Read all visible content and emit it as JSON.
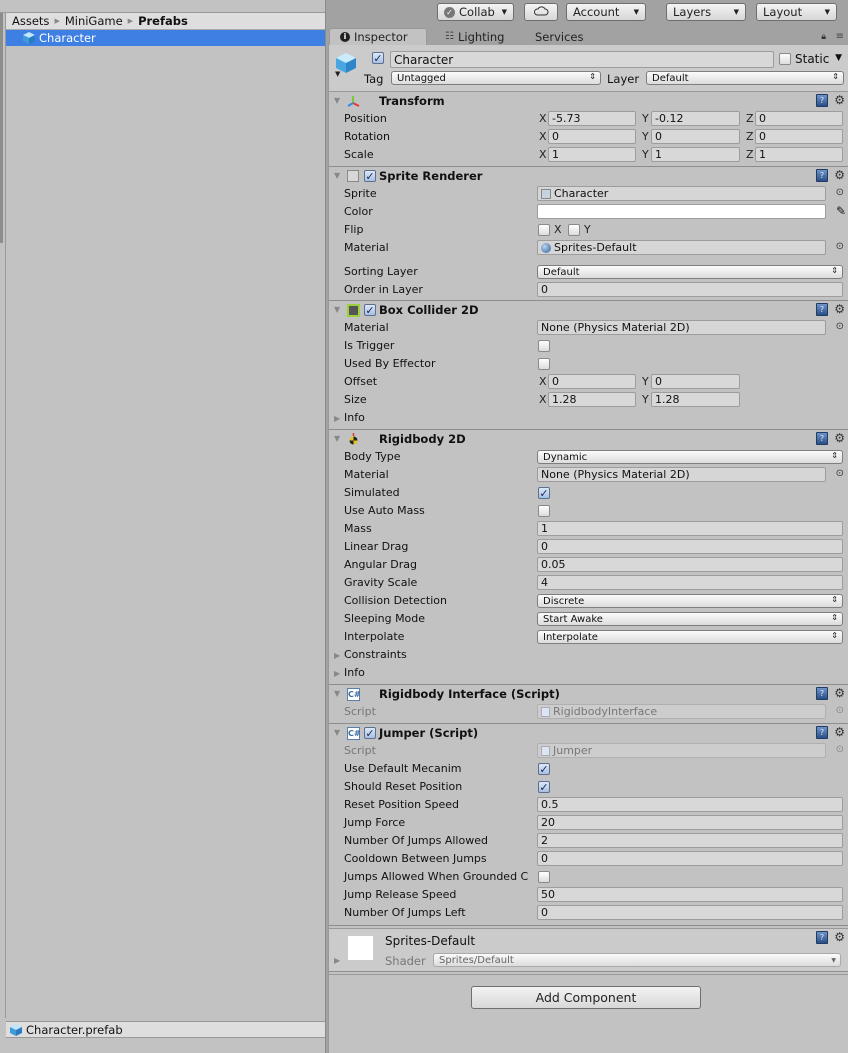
{
  "project": {
    "breadcrumb": [
      "Assets",
      "MiniGame",
      "Prefabs"
    ],
    "selected_item": "Character",
    "footer_file": "Character.prefab"
  },
  "toolbar": {
    "collab": "Collab",
    "account": "Account",
    "layers": "Layers",
    "layout": "Layout"
  },
  "tabs": [
    {
      "label": "Inspector",
      "icon": "info-icon",
      "active": true
    },
    {
      "label": "Lighting",
      "icon": "lighting-icon",
      "active": false
    },
    {
      "label": "Services",
      "icon": "",
      "active": false
    }
  ],
  "header": {
    "object_name": "Character",
    "active": true,
    "static_label": "Static",
    "static": false,
    "tag_label": "Tag",
    "tag_value": "Untagged",
    "layer_label": "Layer",
    "layer_value": "Default"
  },
  "transform": {
    "title": "Transform",
    "rows": [
      {
        "label": "Position",
        "x": "-5.73",
        "y": "-0.12",
        "z": "0"
      },
      {
        "label": "Rotation",
        "x": "0",
        "y": "0",
        "z": "0"
      },
      {
        "label": "Scale",
        "x": "1",
        "y": "1",
        "z": "1"
      }
    ]
  },
  "sprite_renderer": {
    "title": "Sprite Renderer",
    "enabled": true,
    "sprite_label": "Sprite",
    "sprite_value": "Character",
    "color_label": "Color",
    "color_value": "#ffffff",
    "flip_label": "Flip",
    "flip_x": "X",
    "flip_y": "Y",
    "material_label": "Material",
    "material_value": "Sprites-Default",
    "sorting_layer_label": "Sorting Layer",
    "sorting_layer_value": "Default",
    "order_label": "Order in Layer",
    "order_value": "0"
  },
  "box_collider": {
    "title": "Box Collider 2D",
    "enabled": true,
    "material_label": "Material",
    "material_value": "None (Physics Material 2D)",
    "is_trigger_label": "Is Trigger",
    "is_trigger": false,
    "used_by_effector_label": "Used By Effector",
    "used_by_effector": false,
    "offset_label": "Offset",
    "offset_x": "0",
    "offset_y": "0",
    "size_label": "Size",
    "size_x": "1.28",
    "size_y": "1.28",
    "info_label": "Info"
  },
  "rigidbody": {
    "title": "Rigidbody 2D",
    "body_type_label": "Body Type",
    "body_type": "Dynamic",
    "material_label": "Material",
    "material_value": "None (Physics Material 2D)",
    "simulated_label": "Simulated",
    "simulated": true,
    "auto_mass_label": "Use Auto Mass",
    "auto_mass": false,
    "fields": [
      {
        "label": "Mass",
        "value": "1"
      },
      {
        "label": "Linear Drag",
        "value": "0"
      },
      {
        "label": "Angular Drag",
        "value": "0.05"
      },
      {
        "label": "Gravity Scale",
        "value": "4"
      }
    ],
    "collision_label": "Collision Detection",
    "collision": "Discrete",
    "sleeping_label": "Sleeping Mode",
    "sleeping": "Start Awake",
    "interpolate_label": "Interpolate",
    "interpolate": "Interpolate",
    "constraints_label": "Constraints",
    "info_label": "Info"
  },
  "rb_interface": {
    "title": "Rigidbody Interface (Script)",
    "script_label": "Script",
    "script_value": "RigidbodyInterface"
  },
  "jumper": {
    "title": "Jumper (Script)",
    "enabled": true,
    "script_label": "Script",
    "script_value": "Jumper",
    "use_mecanim_label": "Use Default Mecanim",
    "use_mecanim": true,
    "reset_pos_label": "Should Reset Position",
    "reset_pos": true,
    "reset_speed_label": "Reset Position Speed",
    "reset_speed": "0.5",
    "jump_force_label": "Jump Force",
    "jump_force": "20",
    "jumps_allowed_label": "Number Of Jumps Allowed",
    "jumps_allowed": "2",
    "cooldown_label": "Cooldown Between Jumps",
    "cooldown": "0",
    "grounded_label": "Jumps Allowed When Grounded C",
    "grounded": false,
    "release_label": "Jump Release Speed",
    "release": "50",
    "jumps_left_label": "Number Of Jumps Left",
    "jumps_left": "0"
  },
  "material_preview": {
    "name": "Sprites-Default",
    "shader_label": "Shader",
    "shader_value": "Sprites/Default"
  },
  "add_component": "Add Component",
  "axis": {
    "x": "X",
    "y": "Y",
    "z": "Z"
  }
}
